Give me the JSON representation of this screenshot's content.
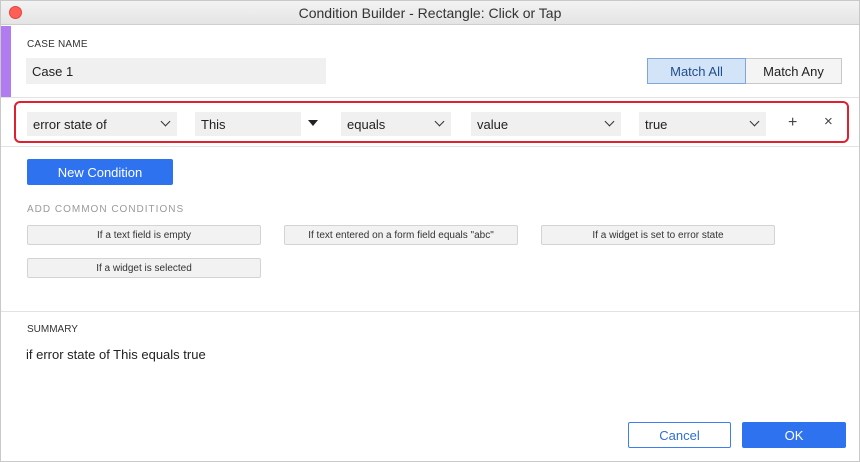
{
  "window": {
    "title": "Condition Builder   -   Rectangle: Click or Tap"
  },
  "case": {
    "label": "CASE NAME",
    "value": "Case 1"
  },
  "match": {
    "all_label": "Match All",
    "any_label": "Match Any",
    "selected": "Match All"
  },
  "condition": {
    "property": "error state of",
    "target": "This",
    "operator": "equals",
    "value_type": "value",
    "value": "true",
    "add_symbol": "+",
    "remove_symbol": "×"
  },
  "actions": {
    "new_condition": "New Condition",
    "cancel": "Cancel",
    "ok": "OK"
  },
  "common": {
    "label": "ADD COMMON CONDITIONS",
    "items": [
      "If a text field is empty",
      "If text entered on a form field equals \"abc\"",
      "If a widget is set to error state",
      "If a widget is selected"
    ]
  },
  "summary": {
    "label": "SUMMARY",
    "text": "if error state of This equals true"
  },
  "colors": {
    "accent": "#2f72f0",
    "highlight_border": "#e0202c",
    "side_accent": "#b07cf0"
  },
  "icons": {
    "close": "close-dot-icon",
    "dropdown": "chevron-down-icon",
    "target_menu": "triangle-down-icon",
    "add": "plus-icon",
    "remove": "x-icon"
  }
}
